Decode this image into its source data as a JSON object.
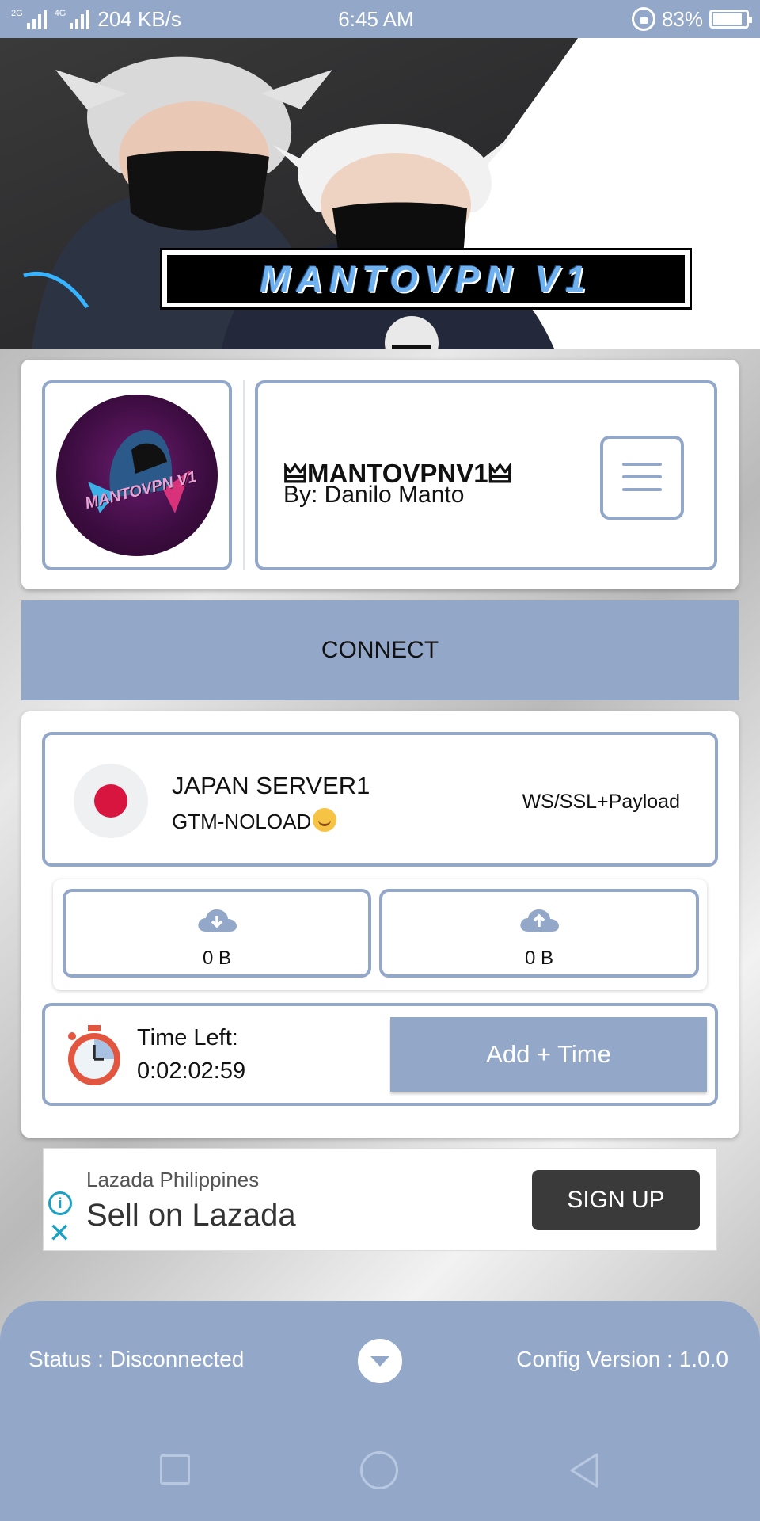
{
  "status_bar": {
    "network_left": "2G",
    "network_right": "4G",
    "speed": "204 KB/s",
    "time": "6:45 AM",
    "battery": "83%"
  },
  "banner": {
    "title": "MANTOVPN V1"
  },
  "header": {
    "logo_text": "MANTOVPN V1",
    "app_name": "🜲MANTOVPNV1🜲",
    "author": "By: Danilo Manto",
    "menu_icon": "hamburger-menu-icon"
  },
  "connect_label": "CONNECT",
  "server": {
    "name": "JAPAN SERVER1",
    "network": "GTM-NOLOAD",
    "protocol": "WS/SSL+Payload",
    "flag_color": "#d7153f"
  },
  "traffic": {
    "download": "0 B",
    "upload": "0 B"
  },
  "timer": {
    "label": "Time Left:",
    "value": "0:02:02:59",
    "add_label": "Add + Time"
  },
  "ad": {
    "brand": "Lazada Philippines",
    "title": "Sell on Lazada",
    "cta": "SIGN UP"
  },
  "bottom": {
    "status": "Status :  Disconnected",
    "config": "Config Version :  1.0.0"
  },
  "colors": {
    "accent": "#93a8c9",
    "ad_icon": "#1aa1c4",
    "ad_button": "#3a3a3a"
  }
}
